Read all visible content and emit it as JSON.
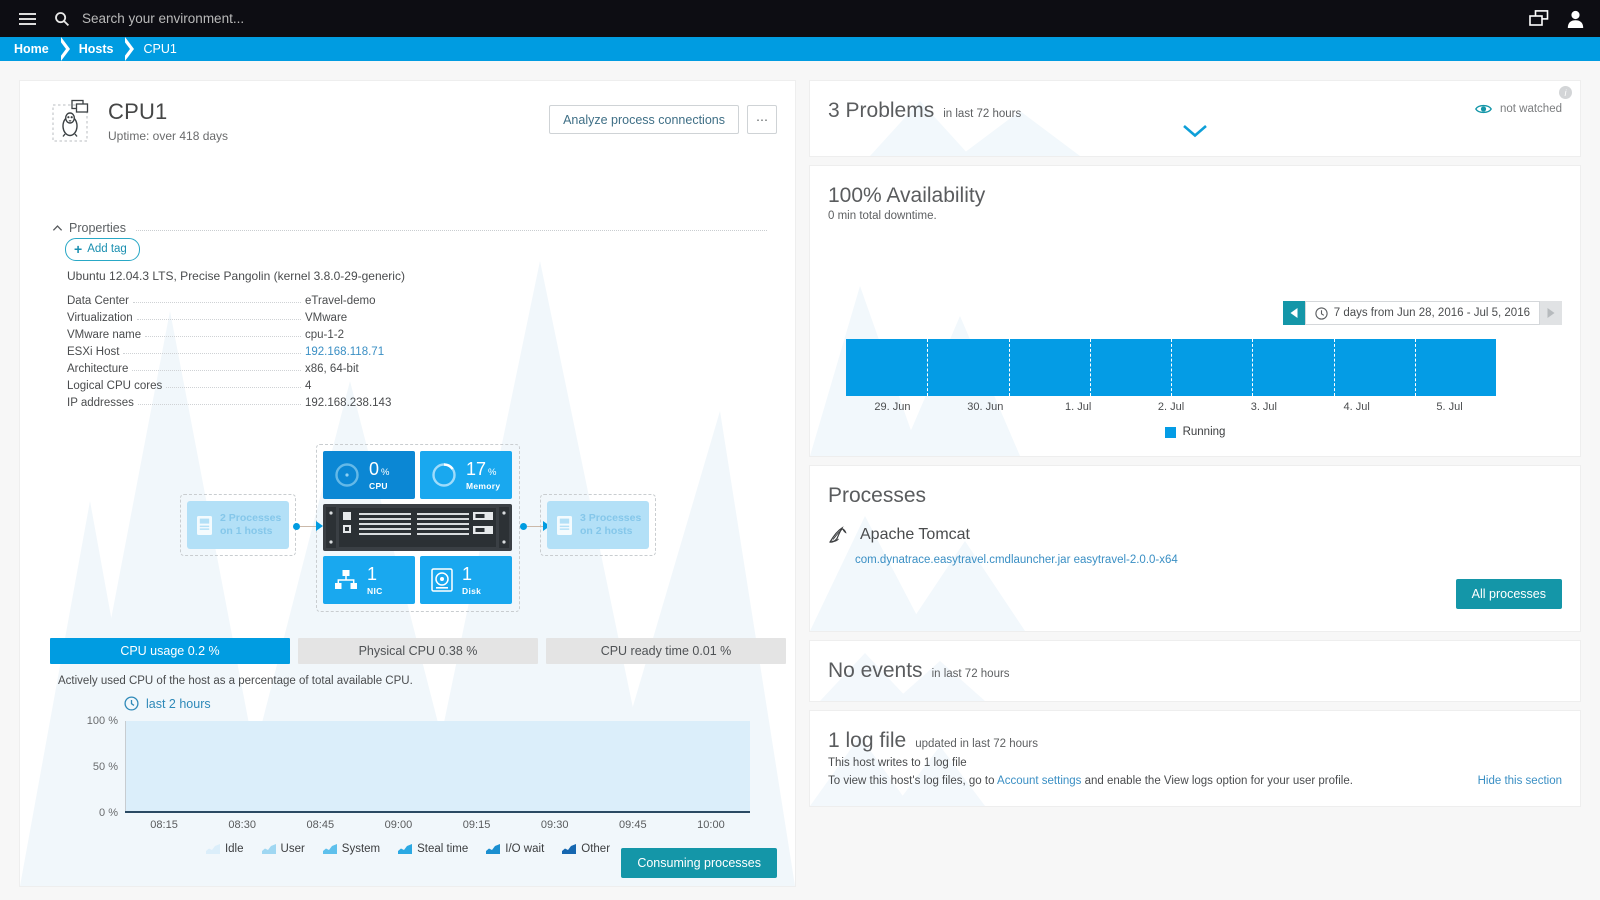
{
  "topbar": {
    "search_placeholder": "Search your environment...",
    "menu_icon": "hamburger-icon",
    "search_icon": "search-icon",
    "chat_icon": "chat-windows-icon",
    "user_icon": "user-account-icon"
  },
  "breadcrumb": {
    "items": [
      "Home",
      "Hosts",
      "CPU1"
    ]
  },
  "host": {
    "name": "CPU1",
    "uptime": "Uptime: over 418 days",
    "icon": "linux-penguin-vm-icon",
    "analyze_button": "Analyze process connections",
    "more_button": "⋯",
    "properties_label": "Properties",
    "add_tag_label": "Add tag",
    "os": "Ubuntu 12.04.3 LTS, Precise Pangolin (kernel 3.8.0-29-generic)",
    "properties": [
      {
        "key": "Data Center",
        "value": "eTravel-demo",
        "link": false
      },
      {
        "key": "Virtualization",
        "value": "VMware",
        "link": false
      },
      {
        "key": "VMware name",
        "value": "cpu-1-2",
        "link": false
      },
      {
        "key": "ESXi Host",
        "value": "192.168.118.71",
        "link": true
      },
      {
        "key": "Architecture",
        "value": "x86, 64-bit",
        "link": false
      },
      {
        "key": "Logical CPU cores",
        "value": "4",
        "link": false
      },
      {
        "key": "IP addresses",
        "value": "192.168.238.143",
        "link": false
      }
    ]
  },
  "infra": {
    "incoming": {
      "line1": "2 Processes",
      "line2": "on 1 hosts"
    },
    "outgoing": {
      "line1": "3 Processes",
      "line2": "on 2 hosts"
    },
    "tiles": [
      {
        "value": "0",
        "unit": "%",
        "label": "CPU",
        "icon": "cpu-donut-icon"
      },
      {
        "value": "17",
        "unit": "%",
        "label": "Memory",
        "icon": "memory-donut-icon"
      },
      {
        "value": "1",
        "unit": "",
        "label": "NIC",
        "icon": "network-icon"
      },
      {
        "value": "1",
        "unit": "",
        "label": "Disk",
        "icon": "disk-icon"
      }
    ]
  },
  "cpu": {
    "tabs": [
      {
        "label": "CPU usage 0.2 %",
        "active": true
      },
      {
        "label": "Physical CPU 0.38 %",
        "active": false
      },
      {
        "label": "CPU ready time 0.01 %",
        "active": false
      }
    ],
    "description": "Actively used CPU of the host as a percentage of total available CPU.",
    "timerange": "last 2 hours",
    "consuming_button": "Consuming processes"
  },
  "chart_data": {
    "type": "area",
    "title": "CPU usage",
    "xlabel": "",
    "ylabel": "%",
    "ylim": [
      0,
      100
    ],
    "yticks": [
      "0 %",
      "50 %",
      "100 %"
    ],
    "ytick_values": [
      0,
      50,
      100
    ],
    "x": [
      "08:15",
      "08:30",
      "08:45",
      "09:00",
      "09:15",
      "09:30",
      "09:45",
      "10:00"
    ],
    "grid": false,
    "legend_position": "bottom",
    "series": [
      {
        "name": "Idle",
        "color": "#dbeefa",
        "values": [
          99.8,
          99.8,
          99.8,
          99.8,
          99.8,
          99.8,
          99.8,
          99.8
        ]
      },
      {
        "name": "User",
        "color": "#9fd7f2",
        "values": [
          0.1,
          0.1,
          0.1,
          0.1,
          0.1,
          0.1,
          0.1,
          0.1
        ]
      },
      {
        "name": "System",
        "color": "#5ec0ec",
        "values": [
          0.1,
          0.1,
          0.1,
          0.1,
          0.1,
          0.1,
          0.1,
          0.1
        ]
      },
      {
        "name": "Steal time",
        "color": "#2ba9e3",
        "values": [
          0,
          0,
          0,
          0,
          0,
          0,
          0,
          0
        ]
      },
      {
        "name": "I/O wait",
        "color": "#1b8fd0",
        "values": [
          0,
          0,
          0,
          0,
          0,
          0,
          0,
          0
        ]
      },
      {
        "name": "Other",
        "color": "#1667b0",
        "values": [
          0,
          0,
          0,
          0,
          0,
          0,
          0,
          0
        ]
      }
    ]
  },
  "problems": {
    "title": "3 Problems",
    "subtitle": "in last 72 hours",
    "watch_label": "not watched",
    "watch_icon": "eye-icon",
    "expand_icon": "chevron-down-icon",
    "info_icon": "info-icon"
  },
  "availability": {
    "title": "100% Availability",
    "subtitle": "0 min total downtime.",
    "daterange": "7 days from Jun 28, 2016 - Jul 5, 2016",
    "prev_icon": "arrow-left-icon",
    "next_icon": "arrow-right-icon",
    "clock_icon": "clock-icon",
    "legend_label": "Running",
    "legend_color": "#049ce5",
    "ticks": [
      "29. Jun",
      "30. Jun",
      "1. Jul",
      "2. Jul",
      "3. Jul",
      "4. Jul",
      "5. Jul"
    ]
  },
  "processes": {
    "title": "Processes",
    "items": [
      {
        "name": "Apache Tomcat",
        "icon": "apache-feather-icon",
        "command": "com.dynatrace.easytravel.cmdlauncher.jar easytravel-2.0.0-x64"
      }
    ],
    "all_button": "All processes"
  },
  "events": {
    "title": "No events",
    "subtitle": "in last 72 hours"
  },
  "logs": {
    "title": "1 log file",
    "subtitle": "updated in last 72 hours",
    "line1": "This host writes to 1 log file",
    "line2_pre": "To view this host's log files, go to ",
    "line2_link": "Account settings",
    "line2_post": " and enable the View logs option for your user profile.",
    "hide_label": "Hide this section"
  },
  "colors": {
    "accent_blue": "#009ce1",
    "accent_teal": "#1496a8",
    "tile_blue": "#19a8ef",
    "tile_blue_dark": "#0b87d4",
    "link_blue": "#3a8fc4",
    "topbar_bg": "#0d0d13"
  }
}
